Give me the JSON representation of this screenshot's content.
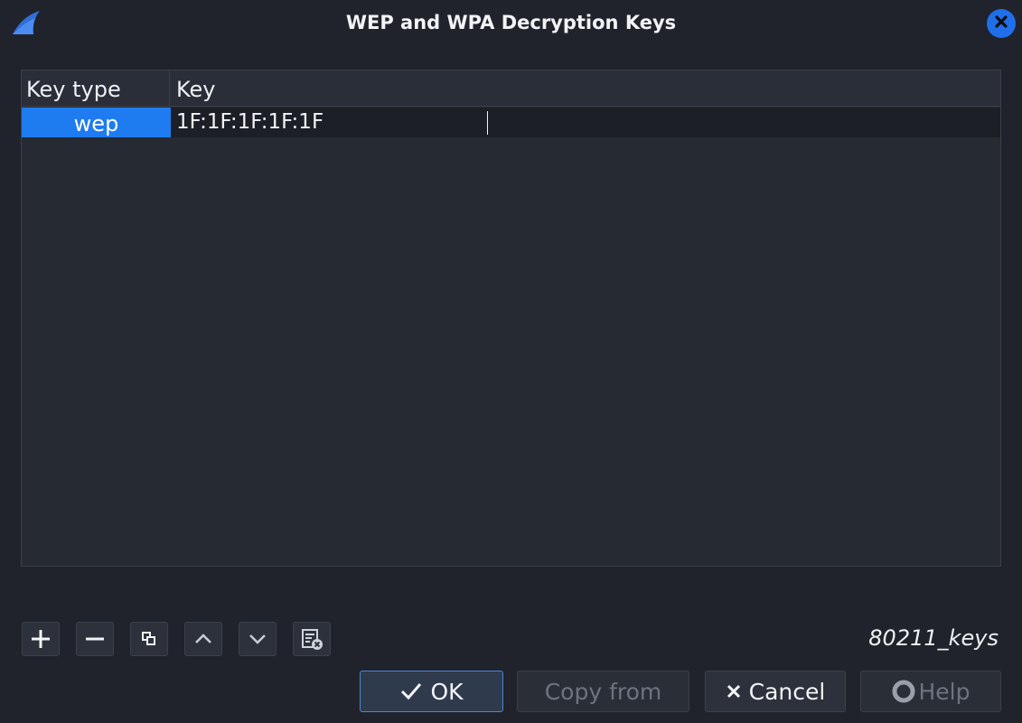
{
  "window": {
    "title": "WEP and WPA Decryption Keys",
    "icon": "shark-fin-icon",
    "close_icon": "close-icon"
  },
  "table": {
    "columns": [
      "Key type",
      "Key"
    ],
    "rows": [
      {
        "key_type": "wep",
        "key": "1F:1F:1F:1F:1F"
      }
    ]
  },
  "toolbar": {
    "buttons": [
      {
        "name": "add",
        "icon": "plus-icon"
      },
      {
        "name": "remove",
        "icon": "minus-icon"
      },
      {
        "name": "copy",
        "icon": "copy-icon"
      },
      {
        "name": "move-up",
        "icon": "chevron-up-icon"
      },
      {
        "name": "move-down",
        "icon": "chevron-down-icon"
      },
      {
        "name": "clear",
        "icon": "clear-list-icon"
      }
    ],
    "filename": "80211_keys"
  },
  "buttons": {
    "ok": "OK",
    "copy_from": "Copy from",
    "cancel": "Cancel",
    "help": "Help"
  },
  "colors": {
    "background": "#20232b",
    "selection": "#1e7cf0",
    "accent": "#1f6feb"
  }
}
